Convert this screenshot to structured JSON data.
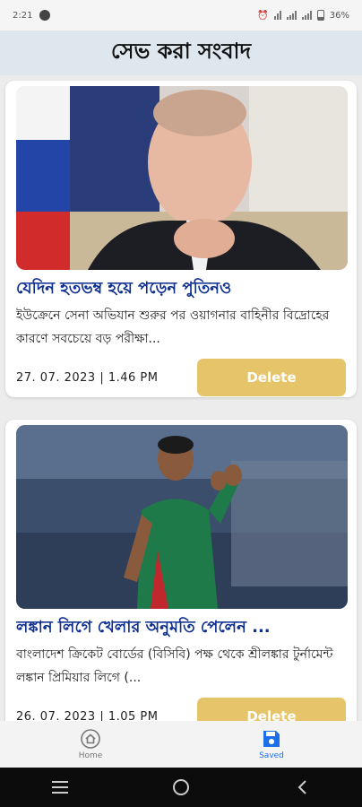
{
  "status_bar": {
    "time": "2:21",
    "battery": "36%"
  },
  "header": {
    "title": "সেভ করা সংবাদ"
  },
  "articles": [
    {
      "title": "যেদিন হতভম্ব হয়ে পড়েন পুতিনও",
      "description": "ইউক্রেনে সেনা অভিযান শুরুর পর ওয়াগনার বাহিনীর বিদ্রোহের কারণে সবচেয়ে বড় পরীক্ষা...",
      "date": "27. 07. 2023 | 1.46 PM",
      "delete_label": "Delete"
    },
    {
      "title": "লঙ্কান লিগে খেলার অনুমতি পেলেন ...",
      "description": "বাংলাদেশ ক্রিকেট বোর্ডের (বিসিবি) পক্ষ থেকে শ্রীলঙ্কার টুর্নামেন্ট লঙ্কান প্রিমিয়ার লিগে (...",
      "date": "26. 07. 2023 | 1.05 PM",
      "delete_label": "Delete"
    }
  ],
  "bottom_nav": [
    {
      "label": "Home",
      "icon": "home-icon",
      "active": false
    },
    {
      "label": "Saved",
      "icon": "save-icon",
      "active": true
    }
  ],
  "colors": {
    "title": "#0f2f8f",
    "delete_button": "#e6c46a",
    "header_bg": "#dfe7ee",
    "active_nav": "#1c6fe8"
  }
}
